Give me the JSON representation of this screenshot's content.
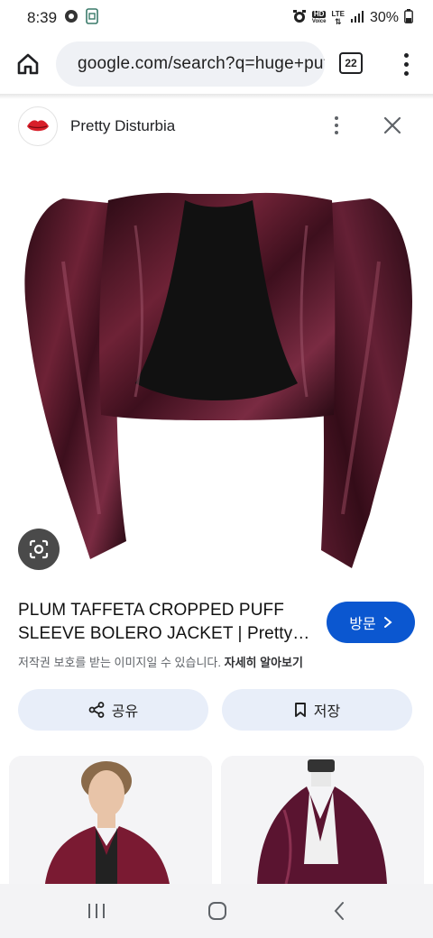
{
  "status_bar": {
    "time": "8:39",
    "battery_text": "30%",
    "hd_badge": "HD",
    "voice_badge": "Voice",
    "lte_badge": "LTE"
  },
  "browser": {
    "url": "google.com/search?q=huge+puff+sleeve+bolero",
    "tab_count": "22"
  },
  "source": {
    "name": "Pretty Disturbia",
    "logo_icon": "lips-icon"
  },
  "result": {
    "title": "PLUM TAFFETA CROPPED PUFF SLEEVE BOLERO JACKET | Pretty…",
    "visit_label": "방문",
    "copyright_text": "저작권 보호를 받는 이미지일 수 있습니다.",
    "copyright_link": "자세히 알아보기"
  },
  "actions": {
    "share_label": "공유",
    "save_label": "저장"
  },
  "colors": {
    "accent": "#0b57d0",
    "button_bg": "#e8eef9",
    "jacket": "#4a1424"
  }
}
